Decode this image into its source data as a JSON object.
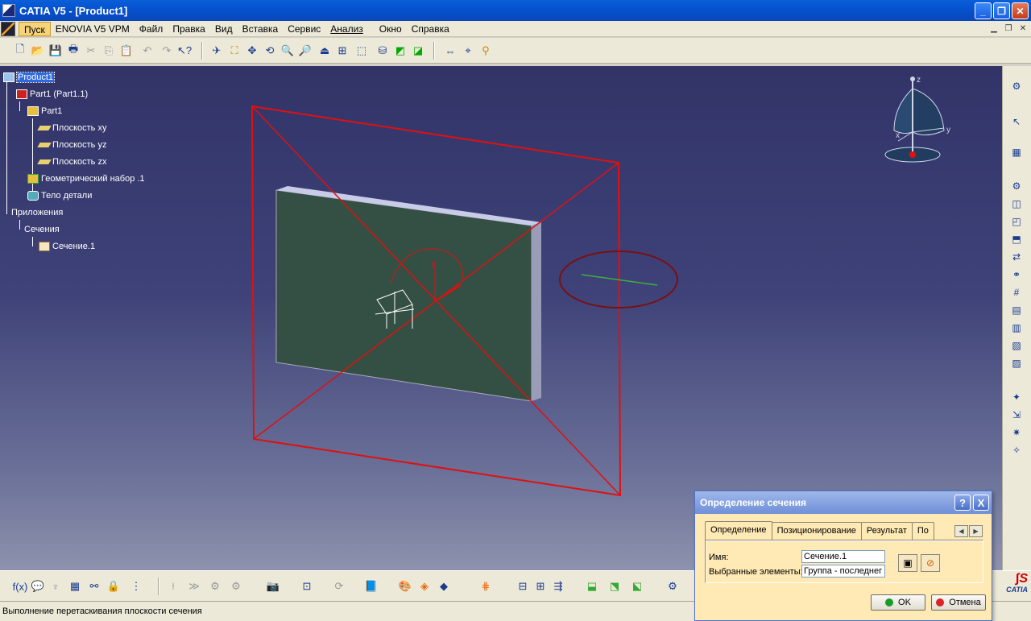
{
  "window": {
    "title": "CATIA V5 - [Product1]"
  },
  "menu": {
    "items": [
      "Пуск",
      "ENOVIA V5 VPM",
      "Файл",
      "Правка",
      "Вид",
      "Вставка",
      "Сервис",
      "Анализ",
      "Окно",
      "Справка"
    ]
  },
  "tree": {
    "root": "Product1",
    "part_instance": "Part1 (Part1.1)",
    "part": "Part1",
    "plane_xy": "Плоскость xy",
    "plane_yz": "Плоскость yz",
    "plane_zx": "Плоскость zx",
    "geom_set": "Геометрический набор .1",
    "body": "Тело детали",
    "apps": "Приложения",
    "sections": "Сечения",
    "section1": "Сечение.1"
  },
  "compass": {
    "z": "z",
    "x": "x",
    "y": "y"
  },
  "model_axis_label": "y",
  "status": {
    "text": "Выполнение перетаскивания плоскости сечения"
  },
  "dialog": {
    "title": "Определение сечения",
    "help_label": "?",
    "close_label": "X",
    "tabs": [
      "Определение",
      "Позиционирование",
      "Результат",
      "По"
    ],
    "name_label": "Имя:",
    "name_value": "Сечение.1",
    "elements_label": "Выбранные элементы:",
    "elements_value": "Группа - последнег",
    "ok_label": "OK",
    "cancel_label": "Отмена"
  },
  "logo": {
    "text": "CATIA"
  },
  "colors": {
    "viewport_top": "#323468",
    "viewport_bottom": "#8d92ad",
    "section_plane": "#e01010",
    "part_face": "#344f43",
    "dialog_bg": "#ffe9b4"
  }
}
